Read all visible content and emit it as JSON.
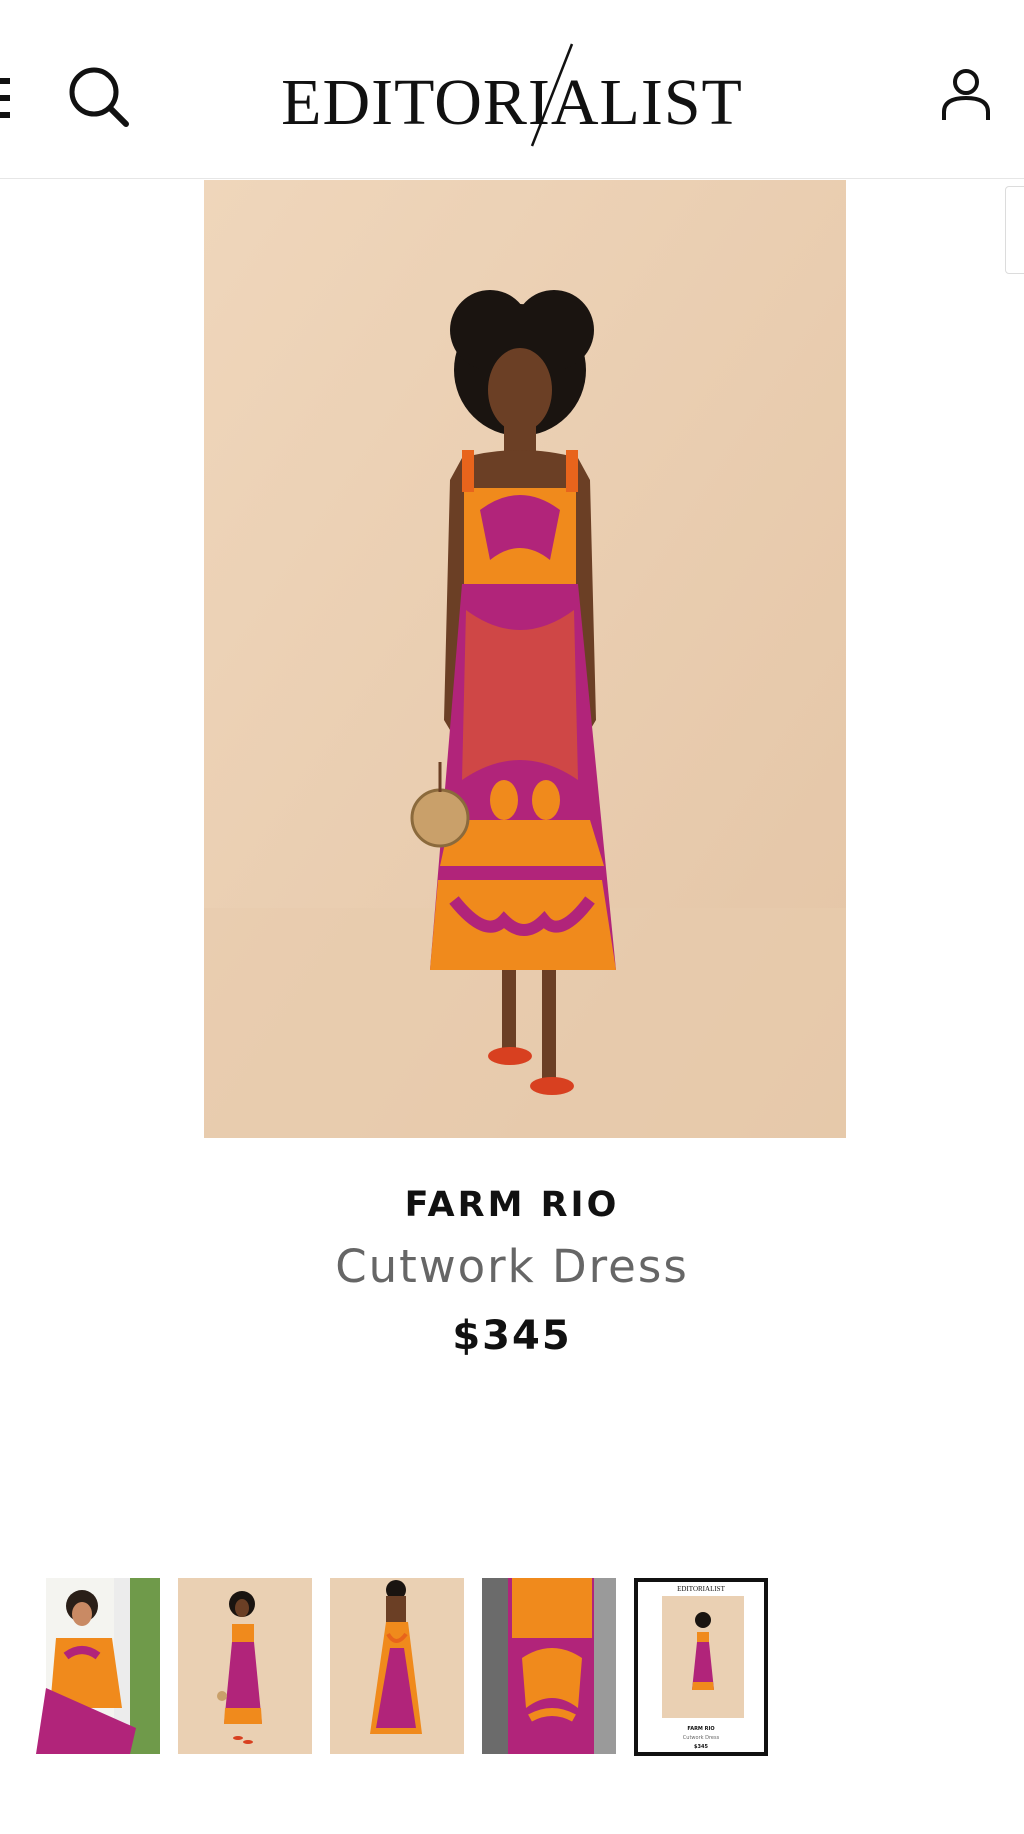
{
  "header": {
    "logo_text": "EDITORIALIST",
    "menu_icon": "hamburger-menu-icon",
    "search_icon": "search-icon",
    "account_icon": "account-icon"
  },
  "product": {
    "brand": "FARM RIO",
    "name": "Cutwork Dress",
    "price": "$345"
  },
  "gallery": {
    "thumbnail_count": 5,
    "selected_index": 4,
    "mini_logo": "EDITORIALIST",
    "mini_brand": "FARM RIO",
    "mini_name": "Cutwork Dress",
    "mini_price": "$345"
  },
  "colors": {
    "dress_orange": "#f08a1c",
    "dress_magenta": "#b1247a",
    "backdrop": "#ead0b3",
    "text_dark": "#111111",
    "text_gray": "#666666"
  }
}
